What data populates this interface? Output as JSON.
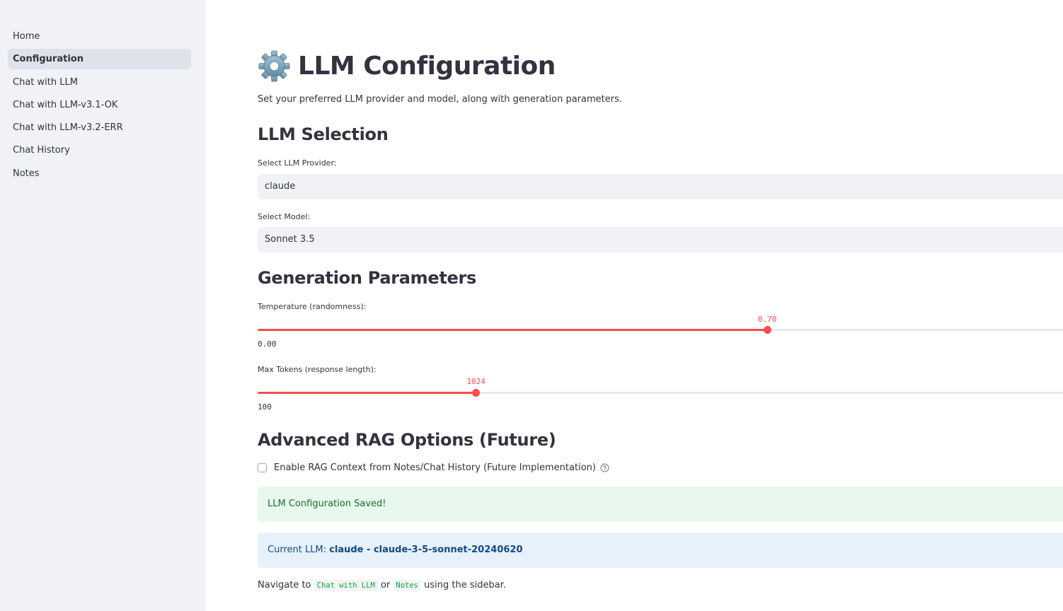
{
  "sidebar": {
    "items": [
      {
        "label": "Home",
        "active": false
      },
      {
        "label": "Configuration",
        "active": true
      },
      {
        "label": "Chat with LLM",
        "active": false
      },
      {
        "label": "Chat with LLM-v3.1-OK",
        "active": false
      },
      {
        "label": "Chat with LLM-v3.2-ERR",
        "active": false
      },
      {
        "label": "Chat History",
        "active": false
      },
      {
        "label": "Notes",
        "active": false
      }
    ]
  },
  "page": {
    "title": "LLM Configuration",
    "title_icon": "gear-icon",
    "subtitle": "Set your preferred LLM provider and model, along with generation parameters."
  },
  "llm_selection": {
    "heading": "LLM Selection",
    "provider_label": "Select LLM Provider:",
    "provider_value": "claude",
    "model_label": "Select Model:",
    "model_value": "Sonnet 3.5"
  },
  "generation": {
    "heading": "Generation Parameters",
    "temperature": {
      "label": "Temperature (randomness):",
      "value_text": "0.70",
      "min_text": "0.00",
      "fraction": 0.7
    },
    "max_tokens": {
      "label": "Max Tokens (response length):",
      "value_text": "1024",
      "min_text": "100",
      "fraction": 0.3
    }
  },
  "rag": {
    "heading": "Advanced RAG Options (Future)",
    "checkbox_label": "Enable RAG Context from Notes/Chat History (Future Implementation)",
    "checked": false
  },
  "alerts": {
    "success": "LLM Configuration Saved!",
    "info_prefix": "Current LLM: ",
    "info_value": "claude - claude-3-5-sonnet-20240620"
  },
  "footer": {
    "prefix": "Navigate to ",
    "link1": "Chat with LLM",
    "middle": " or ",
    "link2": "Notes",
    "suffix": " using the sidebar."
  },
  "colors": {
    "accent": "#ff4b4b",
    "sidebar_bg": "#f0f2f6",
    "success_bg": "#e8f8ec",
    "info_bg": "#e7f1fb"
  }
}
